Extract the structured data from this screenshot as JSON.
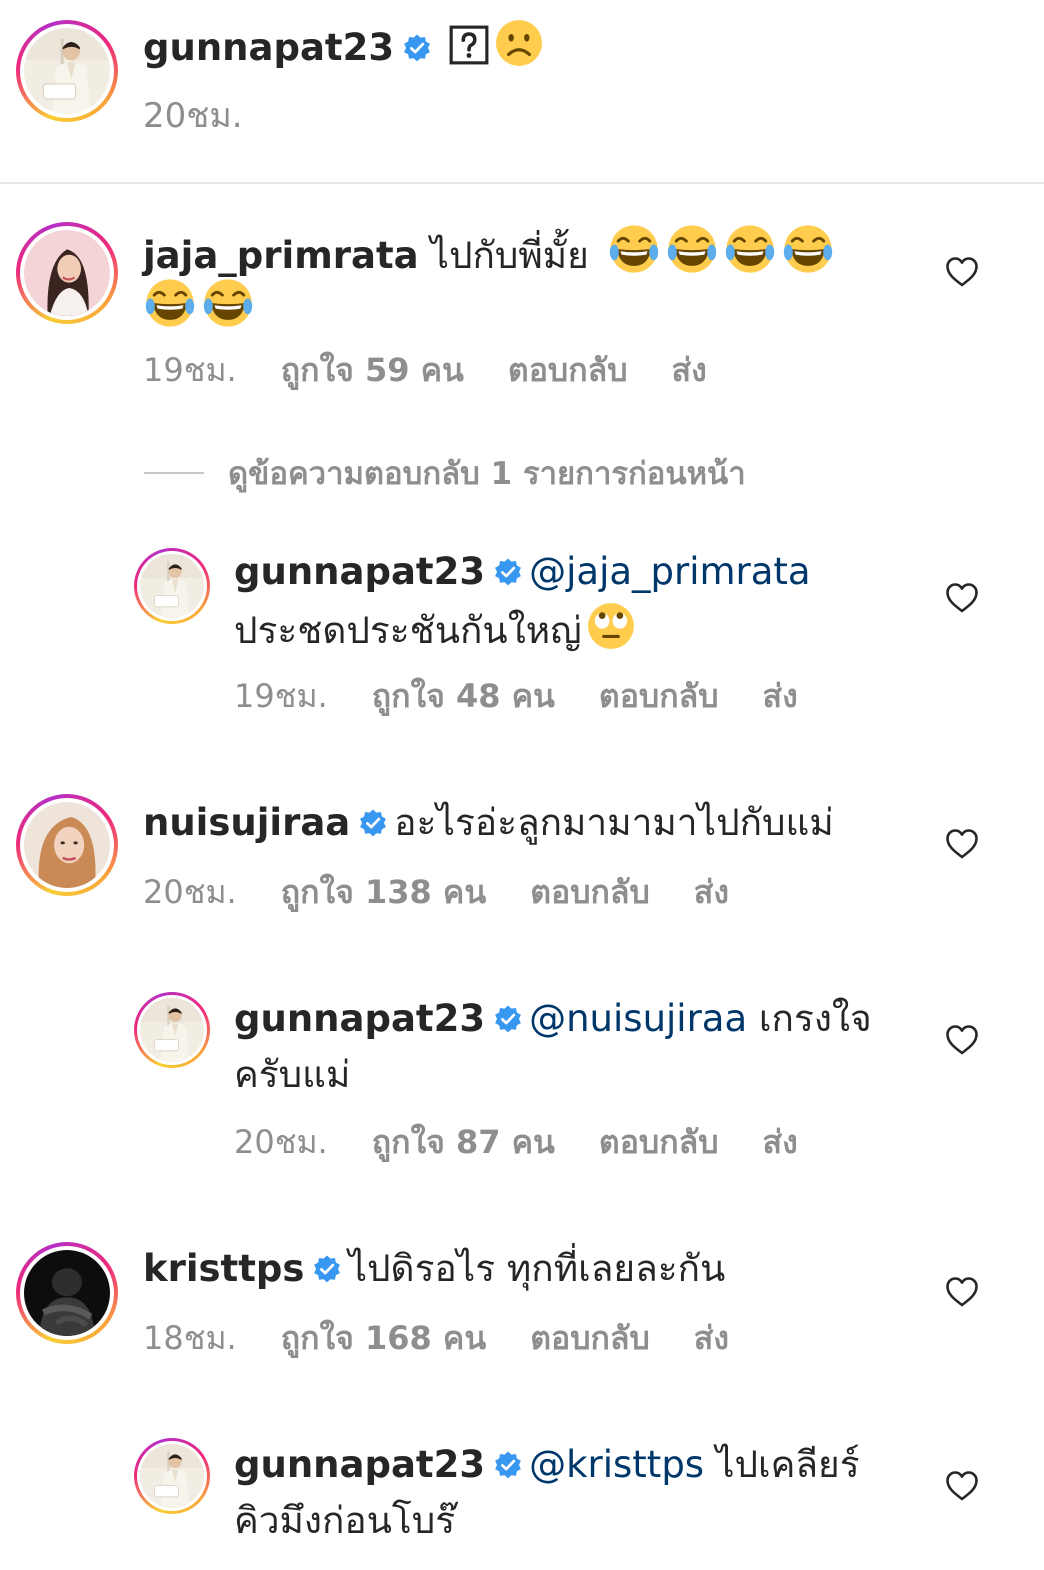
{
  "post": {
    "username": "gunnapat23",
    "time": "20ชม."
  },
  "comments": [
    {
      "username": "jaja_primrata",
      "text_line1": "ไปกับพี่มั้ย",
      "emoji_line1": "😂😂😂😂",
      "emoji_line2": "😂😂",
      "time": "19ชม.",
      "likes": "ถูกใจ 59 คน",
      "reply": "ตอบกลับ",
      "send": "ส่ง",
      "view_replies": "ดูข้อความตอบกลับ 1 รายการก่อนหน้า",
      "replies": [
        {
          "username": "gunnapat23",
          "mention": "@jaja_primrata",
          "text_line2": "ประชดประชันกันใหญ่",
          "time": "19ชม.",
          "likes": "ถูกใจ 48 คน",
          "reply": "ตอบกลับ",
          "send": "ส่ง"
        }
      ]
    },
    {
      "username": "nuisujiraa",
      "text_line1": "อะไรอ่ะลูกมามามาไปกับแม่",
      "time": "20ชม.",
      "likes": "ถูกใจ 138 คน",
      "reply": "ตอบกลับ",
      "send": "ส่ง",
      "replies": [
        {
          "username": "gunnapat23",
          "mention": "@nuisujiraa",
          "text_line1": "เกรงใจ",
          "text_line2": "ครับแม่",
          "time": "20ชม.",
          "likes": "ถูกใจ 87 คน",
          "reply": "ตอบกลับ",
          "send": "ส่ง"
        }
      ]
    },
    {
      "username": "kristtps",
      "text_line1": "ไปดิรอไร ทุกที่เลยละกัน",
      "time": "18ชม.",
      "likes": "ถูกใจ 168 คน",
      "reply": "ตอบกลับ",
      "send": "ส่ง",
      "replies": [
        {
          "username": "gunnapat23",
          "mention": "@kristtps",
          "text_line1": "ไปเคลียร์",
          "text_line2": "คิวมึงก่อนโบร๊"
        }
      ]
    }
  ],
  "colors": {
    "verified": "#3897f0",
    "mention": "#00376b",
    "meta": "#8e8e8e"
  }
}
